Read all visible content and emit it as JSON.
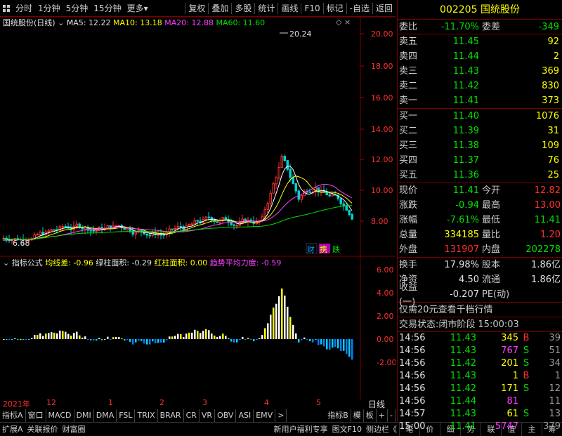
{
  "toolbar": {
    "left_items": [
      "分时",
      "1分钟",
      "5分钟",
      "15分钟",
      "更多"
    ],
    "right_items": [
      "复权",
      "叠加",
      "多股",
      "统计",
      "画线",
      "F10",
      "标记",
      "-自选",
      "返回"
    ]
  },
  "kline": {
    "stock_name": "国统股份(日线)",
    "ma5": "MA5: 12.22",
    "ma10": "MA10: 13.18",
    "ma20": "MA20: 12.88",
    "ma60": "MA60: 11.60",
    "high_label": "20.24",
    "low_label": "6.68",
    "badges": [
      "财",
      "携",
      "跌"
    ],
    "y_ticks": [
      "20.00",
      "18.00",
      "16.00",
      "14.00",
      "12.00",
      "10.00",
      "8.00"
    ]
  },
  "indicator": {
    "name": "指标公式",
    "v1": "均线差: -0.96",
    "v2": "绿柱面积: -0.29",
    "v3": "红柱面积: 0.00",
    "v4": "趋势平均力度: -0.59",
    "y_ticks": [
      "6.00",
      "4.00",
      "2.00",
      "0.00",
      "-2.00"
    ]
  },
  "xaxis": {
    "labels": [
      "2021年",
      "12",
      "1",
      "2",
      "3",
      "4",
      "5"
    ],
    "mode": "日线"
  },
  "bottom_tabs": [
    "指标A",
    "窗口",
    "MACD",
    "DMI",
    "DMA",
    "FSL",
    "TRIX",
    "BRAR",
    "CR",
    "VR",
    "OBV",
    "ASI",
    "EMV",
    ">",
    "指标B",
    "模",
    "板",
    "+",
    "-"
  ],
  "statusbar": {
    "left": [
      "扩展A",
      "关联报价",
      "财富圈"
    ],
    "mid": [
      "新用户福利专享",
      "图文F10",
      "侧边栏《"
    ],
    "right": [
      "笔",
      "价",
      "细",
      "势",
      "联",
      "值",
      "主",
      "筹"
    ]
  },
  "quote": {
    "code": "002205",
    "name": "国统股份",
    "webi_label": "委比",
    "webi": "-11.70%",
    "weicha_label": "委差",
    "weicha": "-349",
    "asks": [
      {
        "label": "卖五",
        "price": "11.45",
        "vol": "92"
      },
      {
        "label": "卖四",
        "price": "11.44",
        "vol": "2"
      },
      {
        "label": "卖三",
        "price": "11.43",
        "vol": "369"
      },
      {
        "label": "卖二",
        "price": "11.42",
        "vol": "830"
      },
      {
        "label": "卖一",
        "price": "11.41",
        "vol": "373"
      }
    ],
    "bids": [
      {
        "label": "买一",
        "price": "11.40",
        "vol": "1076"
      },
      {
        "label": "买二",
        "price": "11.39",
        "vol": "31"
      },
      {
        "label": "买三",
        "price": "11.38",
        "vol": "109"
      },
      {
        "label": "买四",
        "price": "11.37",
        "vol": "76"
      },
      {
        "label": "买五",
        "price": "11.36",
        "vol": "25"
      }
    ],
    "stats": [
      {
        "l1": "现价",
        "v1": "11.41",
        "l2": "今开",
        "v2": "12.82"
      },
      {
        "l1": "涨跌",
        "v1": "-0.94",
        "l2": "最高",
        "v2": "13.00"
      },
      {
        "l1": "涨幅",
        "v1": "-7.61%",
        "l2": "最低",
        "v2": "11.41"
      },
      {
        "l1": "总量",
        "v1": "334185",
        "l2": "量比",
        "v2": "1.20"
      },
      {
        "l1": "外盘",
        "v1": "131907",
        "l2": "内盘",
        "v2": "202278"
      }
    ],
    "stats2": [
      {
        "l1": "换手",
        "v1": "17.98%",
        "l2": "股本",
        "v2": "1.86亿"
      },
      {
        "l1": "净资",
        "v1": "4.50",
        "l2": "流通",
        "v2": "1.86亿"
      },
      {
        "l1": "收益(一)",
        "v1": "-0.207",
        "l2": "PE(动)",
        "v2": ""
      }
    ],
    "promo": "仅需20元查看千档行情",
    "trade_status_label": "交易状态:",
    "trade_status": "闭市阶段",
    "trade_time": "15:00:03",
    "ticks": [
      {
        "t": "14:56",
        "p": "11.43",
        "v": "345",
        "d": "B",
        "n": "39"
      },
      {
        "t": "14:56",
        "p": "11.43",
        "v": "767",
        "d": "S",
        "n": "51"
      },
      {
        "t": "14:56",
        "p": "11.42",
        "v": "201",
        "d": "S",
        "n": "34"
      },
      {
        "t": "14:56",
        "p": "11.43",
        "v": "1",
        "d": "B",
        "n": "1"
      },
      {
        "t": "14:56",
        "p": "11.42",
        "v": "171",
        "d": "S",
        "n": "12"
      },
      {
        "t": "14:56",
        "p": "11.44",
        "v": "81",
        "d": "",
        "n": "11"
      },
      {
        "t": "14:57",
        "p": "11.43",
        "v": "61",
        "d": "S",
        "n": "13"
      },
      {
        "t": "15:00",
        "p": "11.41",
        "v": "5747",
        "d": "",
        "n": "379"
      }
    ]
  }
}
